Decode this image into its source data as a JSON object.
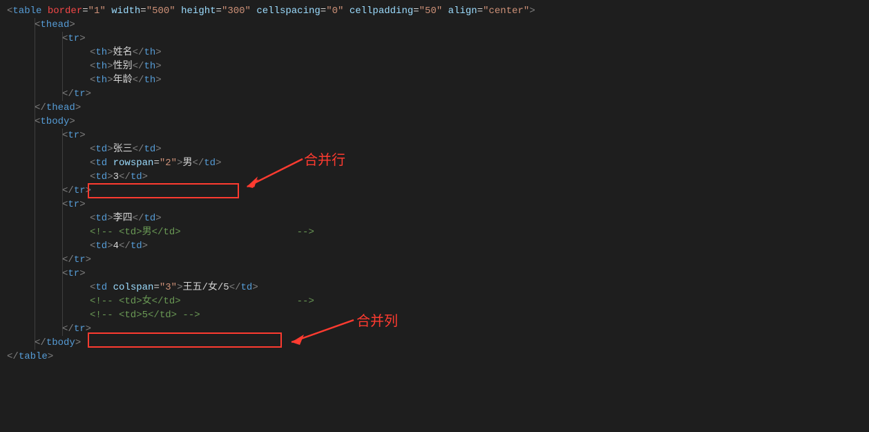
{
  "tags": {
    "table": "table",
    "thead": "thead",
    "tbody": "tbody",
    "tr": "tr",
    "th": "th",
    "td": "td"
  },
  "attrs": {
    "border": "border",
    "width": "width",
    "height": "height",
    "cellspacing": "cellspacing",
    "cellpadding": "cellpadding",
    "align": "align",
    "rowspan": "rowspan",
    "colspan": "colspan"
  },
  "vals": {
    "border": "\"1\"",
    "width": "\"500\"",
    "height": "\"300\"",
    "cellspacing": "\"0\"",
    "cellpadding": "\"50\"",
    "align": "\"center\"",
    "rowspan": "\"2\"",
    "colspan": "\"3\""
  },
  "text": {
    "th1": "姓名",
    "th2": "性别",
    "th3": "年龄",
    "r1c1": "张三",
    "r1c2": "男",
    "r1c3": "3",
    "r2c1": "李四",
    "r2c3": "4",
    "r3": "王五/女/5",
    "cmt1": "<!-- <td>男</td>                    -->",
    "cmt2": "<!-- <td>女</td>                    -->",
    "cmt3": "<!-- <td>5</td> -->"
  },
  "anno": {
    "rowspan_label": "合并行",
    "colspan_label": "合并列"
  }
}
